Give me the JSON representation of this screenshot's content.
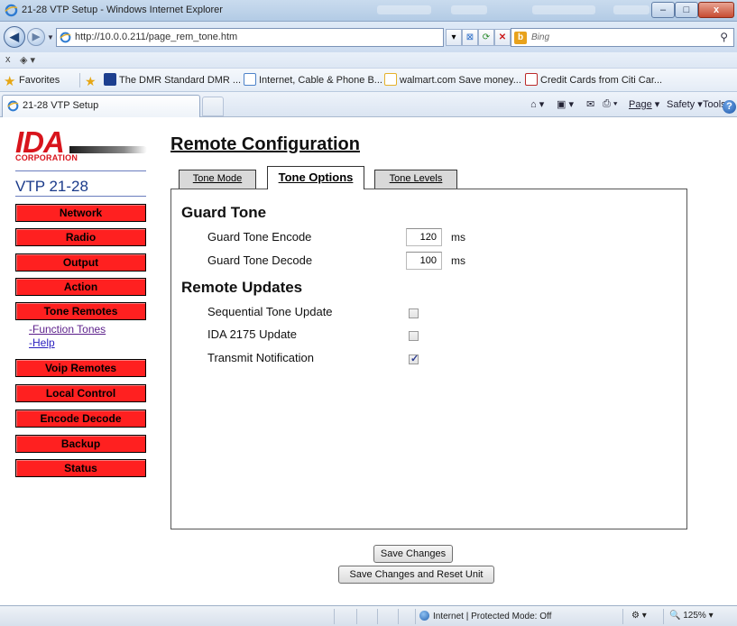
{
  "window": {
    "title": "21-28 VTP Setup - Windows Internet Explorer",
    "minimize": "–",
    "maximize": "□",
    "close": "x"
  },
  "address_bar": {
    "url": "http://10.0.0.211/page_rem_tone.htm",
    "search_placeholder": "Bing",
    "back": "◀",
    "forward": "▶",
    "refresh": "⟳",
    "stop": "✕",
    "compat": "⊠"
  },
  "small_toolbar": {
    "close_x": "x",
    "addon": "◈ ▾"
  },
  "favorites_bar": {
    "favorites_label": "Favorites",
    "items": [
      "The DMR Standard  DMR ...",
      "Internet, Cable & Phone B...",
      "walmart.com Save money...",
      "Credit Cards from Citi Car..."
    ]
  },
  "tabs": {
    "active_tab": "21-28 VTP Setup"
  },
  "command_bar": {
    "home": "⌂ ▾",
    "feeds": "▣ ▾",
    "mail": "✉",
    "print": "⎙ ▾",
    "page_label": "Page",
    "safety_label": "Safety",
    "tools_label": "Tools",
    "help": "?"
  },
  "sidebar": {
    "logo_text": "IDA",
    "logo_subtext": "CORPORATION",
    "model": "VTP 21-28",
    "items": [
      {
        "label": "Network"
      },
      {
        "label": "Radio"
      },
      {
        "label": "Output"
      },
      {
        "label": "Action"
      },
      {
        "label": "Tone Remotes"
      },
      {
        "label": "Voip Remotes"
      },
      {
        "label": "Local Control"
      },
      {
        "label": "Encode Decode"
      },
      {
        "label": "Backup"
      },
      {
        "label": "Status"
      }
    ],
    "sublinks": [
      "-Function Tones",
      "-Help"
    ]
  },
  "main": {
    "title": "Remote Configuration",
    "tabs": [
      {
        "label": "Tone Mode"
      },
      {
        "label": "Tone Options"
      },
      {
        "label": "Tone Levels"
      }
    ],
    "guard_tone": {
      "heading": "Guard Tone",
      "encode_label": "Guard Tone Encode",
      "encode_value": "120",
      "decode_label": "Guard Tone Decode",
      "decode_value": "100",
      "unit": "ms"
    },
    "remote_updates": {
      "heading": "Remote Updates",
      "items": [
        {
          "label": "Sequential Tone Update",
          "checked": false
        },
        {
          "label": "IDA 2175 Update",
          "checked": false
        },
        {
          "label": "Transmit Notification",
          "checked": true
        }
      ]
    },
    "save_button": "Save Changes",
    "save_reset_button": "Save Changes and Reset Unit"
  },
  "status_bar": {
    "zone": "Internet | Protected Mode: Off",
    "zoom": "125%",
    "zoom_icon": "🔍"
  }
}
